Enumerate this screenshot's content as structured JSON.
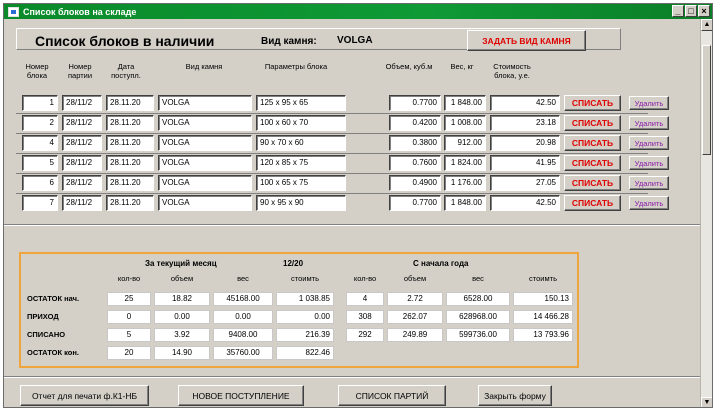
{
  "window": {
    "title": "Список блоков на складе",
    "min_label": "_",
    "max_label": "□",
    "close_label": "×"
  },
  "header": {
    "title": "Список блоков в наличии",
    "stone_label": "Вид камня:",
    "stone_value": "VOLGA",
    "set_stone_button": "ЗАДАТЬ ВИД КАМНЯ"
  },
  "columns": {
    "block_no": "Номер блока",
    "batch_no": "Номер партии",
    "date": "Дата поступл.",
    "stone": "Вид камня",
    "params": "Параметры блока",
    "volume": "Объем, куб.м",
    "weight": "Вес, кг",
    "cost": "Стоимость блока, у.е."
  },
  "rows": [
    {
      "block": "1",
      "batch": "28/11/2",
      "date": "28.11.20",
      "stone": "VOLGA",
      "params": "125 x 95 x 65",
      "volume": "0.7700",
      "weight": "1 848.00",
      "cost": "42.50",
      "writeoff": "СПИСАТЬ",
      "delete": "Удалить"
    },
    {
      "block": "2",
      "batch": "28/11/2",
      "date": "28.11.20",
      "stone": "VOLGA",
      "params": "100 x 60 x 70",
      "volume": "0.4200",
      "weight": "1 008.00",
      "cost": "23.18",
      "writeoff": "СПИСАТЬ",
      "delete": "Удалить"
    },
    {
      "block": "4",
      "batch": "28/11/2",
      "date": "28.11.20",
      "stone": "VOLGA",
      "params": "90 x 70 x 60",
      "volume": "0.3800",
      "weight": "912.00",
      "cost": "20.98",
      "writeoff": "СПИСАТЬ",
      "delete": "Удалить"
    },
    {
      "block": "5",
      "batch": "28/11/2",
      "date": "28.11.20",
      "stone": "VOLGA",
      "params": "120 x 85 x 75",
      "volume": "0.7600",
      "weight": "1 824.00",
      "cost": "41.95",
      "writeoff": "СПИСАТЬ",
      "delete": "Удалить"
    },
    {
      "block": "6",
      "batch": "28/11/2",
      "date": "28.11.20",
      "stone": "VOLGA",
      "params": "100 x 65 x 75",
      "volume": "0.4900",
      "weight": "1 176.00",
      "cost": "27.05",
      "writeoff": "СПИСАТЬ",
      "delete": "Удалить"
    },
    {
      "block": "7",
      "batch": "28/11/2",
      "date": "28.11.20",
      "stone": "VOLGA",
      "params": "90 x 95 x 90",
      "volume": "0.7700",
      "weight": "1 848.00",
      "cost": "42.50",
      "writeoff": "СПИСАТЬ",
      "delete": "Удалить"
    }
  ],
  "summary": {
    "month_title": "За текущий месяц",
    "month_value": "12/20",
    "year_title": "С начала года",
    "headers": {
      "qty": "кол-во",
      "volume": "объем",
      "weight": "вес",
      "cost": "стоимть"
    },
    "rows": [
      {
        "label": "ОСТАТОК нач.",
        "m_qty": "25",
        "m_vol": "18.82",
        "m_wt": "45168.00",
        "m_cost": "1 038.85",
        "y_qty": "4",
        "y_vol": "2.72",
        "y_wt": "6528.00",
        "y_cost": "150.13"
      },
      {
        "label": "ПРИХОД",
        "m_qty": "0",
        "m_vol": "0.00",
        "m_wt": "0.00",
        "m_cost": "0.00",
        "y_qty": "308",
        "y_vol": "262.07",
        "y_wt": "628968.00",
        "y_cost": "14 466.28"
      },
      {
        "label": "СПИСАНО",
        "m_qty": "5",
        "m_vol": "3.92",
        "m_wt": "9408.00",
        "m_cost": "216.39",
        "y_qty": "292",
        "y_vol": "249.89",
        "y_wt": "599736.00",
        "y_cost": "13 793.96"
      },
      {
        "label": "ОСТАТОК кон.",
        "m_qty": "20",
        "m_vol": "14.90",
        "m_wt": "35760.00",
        "m_cost": "822.46",
        "y_qty": "",
        "y_vol": "",
        "y_wt": "",
        "y_cost": ""
      }
    ]
  },
  "footer": {
    "print_button": "Отчет для печати ф.К1-НБ",
    "new_arrival_button": "НОВОЕ ПОСТУПЛЕНИЕ",
    "batches_button": "СПИСОК ПАРТИЙ",
    "close_button": "Закрыть форму"
  },
  "colors": {
    "titlebar": "#0a8a2a",
    "danger": "#e00000",
    "delete": "#8a1aa8",
    "summary_border": "#f0a43c",
    "form_bg": "#d4d0c8"
  }
}
